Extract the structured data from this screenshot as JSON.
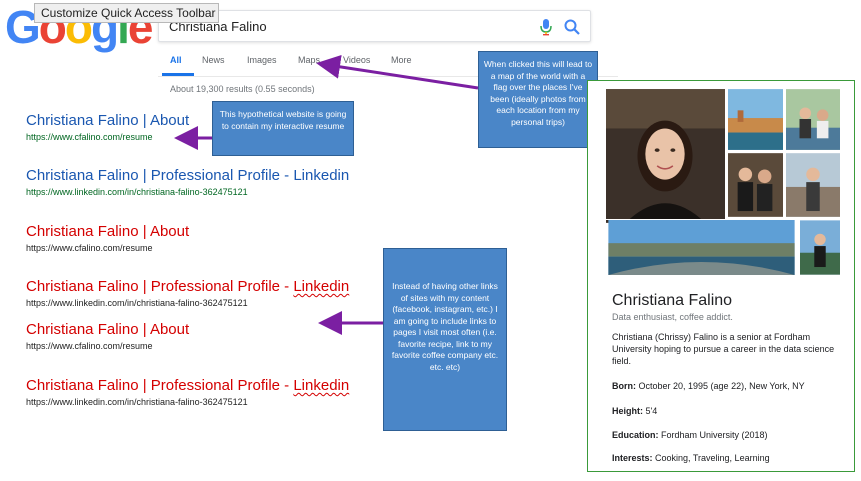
{
  "tooltip": "Customize Quick Access Toolbar",
  "logo": {
    "letters": [
      "G",
      "o",
      "o",
      "g",
      "l",
      "e"
    ],
    "colors": [
      "#4285f4",
      "#ea4335",
      "#fbbc05",
      "#4285f4",
      "#34a853",
      "#ea4335"
    ]
  },
  "search": {
    "value": "Christiana Falino",
    "mic_icon": "mic-icon",
    "search_icon": "search-icon"
  },
  "tabs": [
    "All",
    "News",
    "Images",
    "Maps",
    "Videos",
    "More"
  ],
  "stats": "About 19,300 results (0.55 seconds)",
  "results": [
    {
      "title": "Christiana Falino | About",
      "url": "https://www.cfalino.com/resume"
    },
    {
      "title": "Christiana Falino | Professional Profile - ",
      "title_link": "Linkedin",
      "url": "https://www.linkedin.com/in/christiana-falino-362475121"
    },
    {
      "title": "Christiana Falino | About",
      "url": "https://www.cfalino.com/resume"
    },
    {
      "title": "Christiana Falino | Professional Profile - ",
      "title_link": "Linkedin",
      "url": "https://www.linkedin.com/in/christiana-falino-362475121"
    },
    {
      "title": "Christiana Falino | About",
      "url": "https://www.cfalino.com/resume"
    },
    {
      "title": "Christiana Falino | Professional Profile - ",
      "title_link": "Linkedin",
      "url": "https://www.linkedin.com/in/christiana-falino-362475121"
    }
  ],
  "notes": {
    "website": "This hypothetical website is going to contain my interactive resume",
    "maps": "When clicked this will lead to a map of the world with a flag over the places I've been (ideally photos from each location from my personal trips)",
    "links": "Instead of having other links of sites with my content (facebook, instagram, etc.) I am going to include links to pages I visit most often (i.e. favorite recipe, link to my favorite coffee company etc. etc. etc)"
  },
  "knowledge_panel": {
    "name": "Christiana Falino",
    "subtitle": "Data enthusiast, coffee addict.",
    "description": "Christiana (Chrissy) Falino is a senior at Fordham University hoping to pursue a career in the data science field.",
    "facts": [
      {
        "label": "Born:",
        "value": " October 20, 1995 (age 22), New York, NY"
      },
      {
        "label": "Height:",
        "value": " 5'4"
      },
      {
        "label": "Education:",
        "value": " Fordham University (2018)"
      },
      {
        "label": "Interests:",
        "value": " Cooking, Traveling, Learning"
      }
    ]
  },
  "colors": {
    "link_blue": "#1a57b0",
    "link_red": "#d40000",
    "url_green": "#006621",
    "note_blue": "#4a86c8",
    "arrow_purple": "#7b1fa2",
    "panel_border": "#3a9a3a"
  }
}
